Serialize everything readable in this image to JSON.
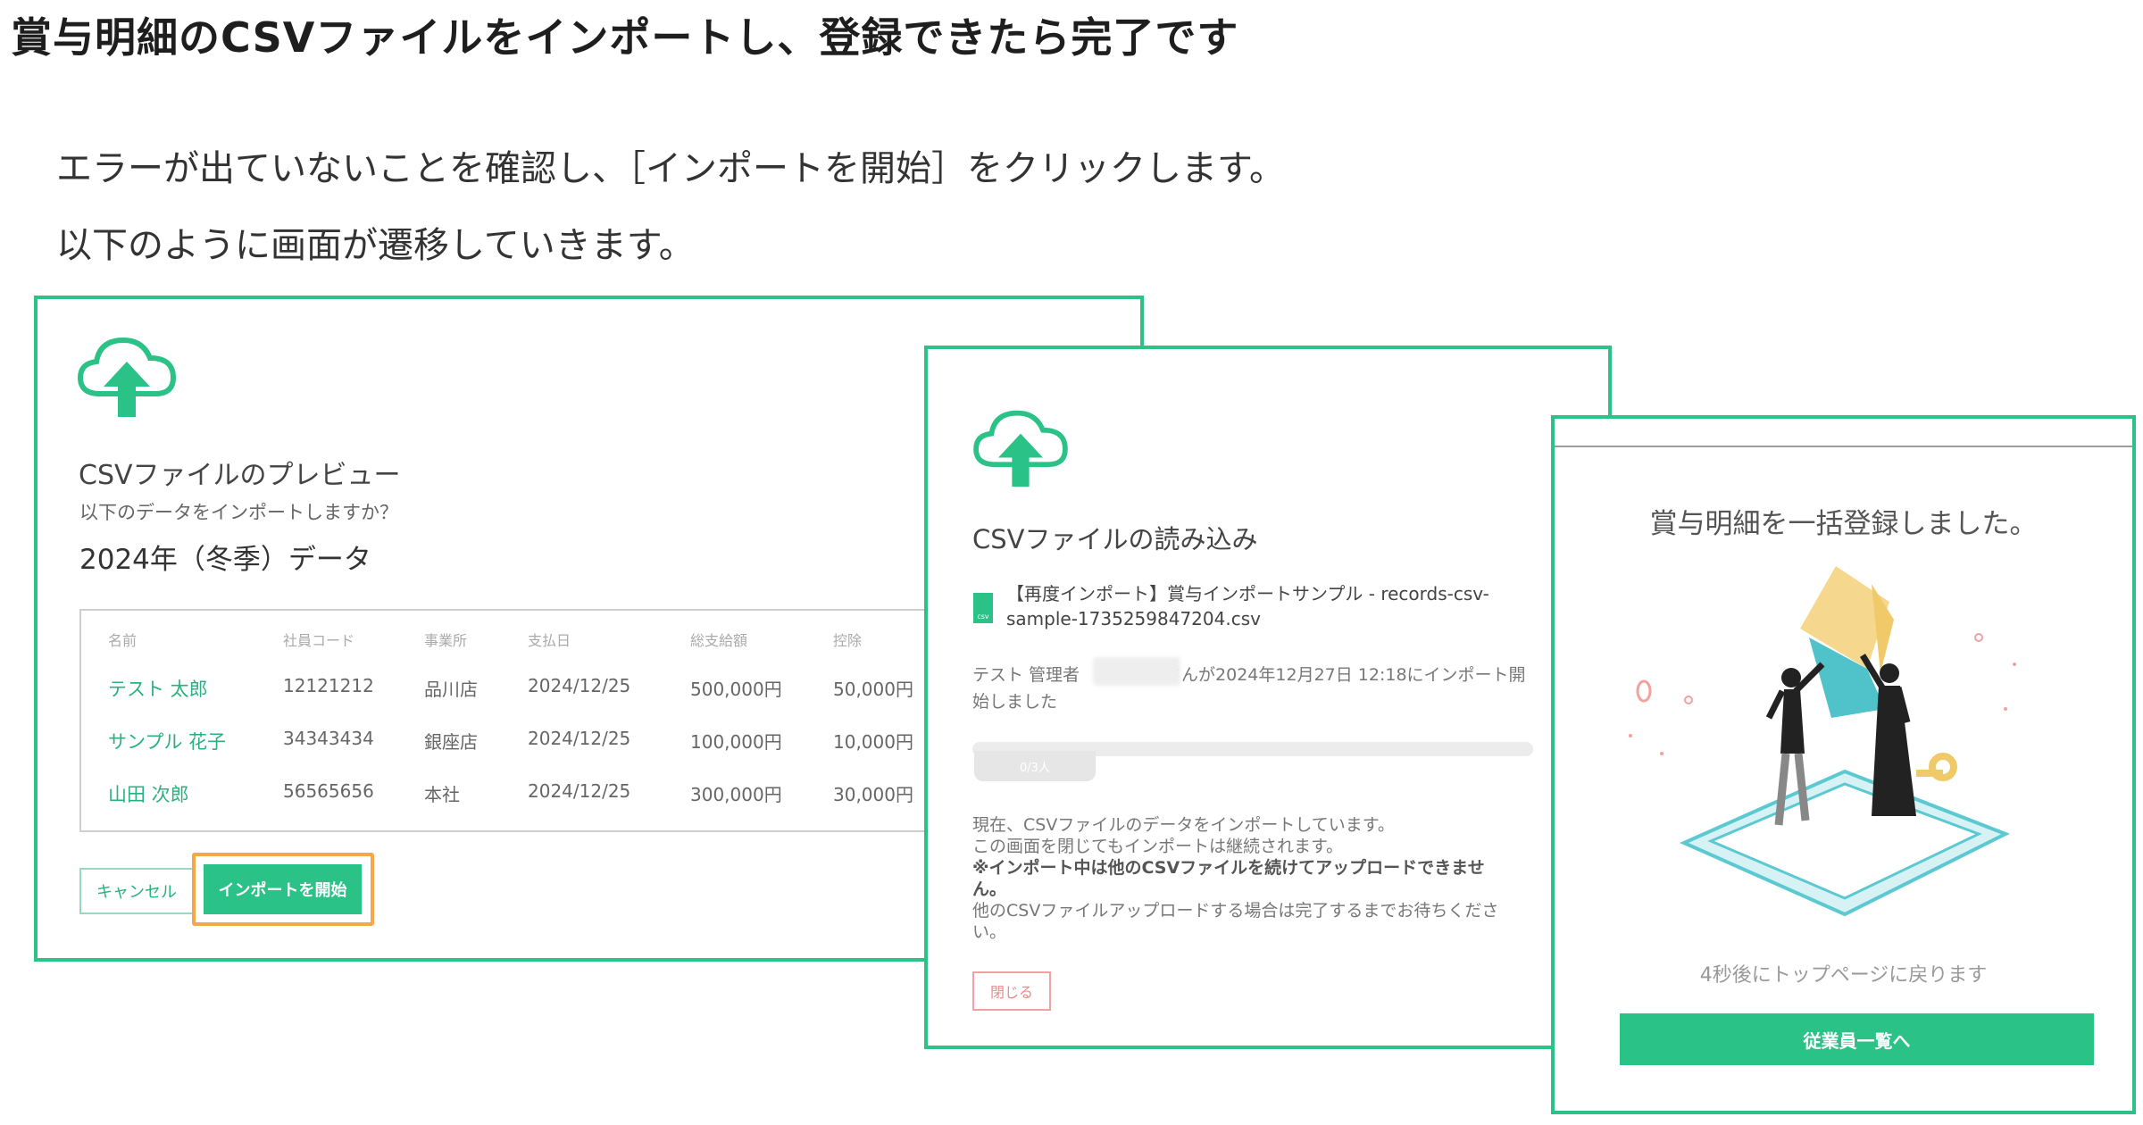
{
  "heading": "賞与明細のCSVファイルをインポートし、登録できたら完了です",
  "paragraphs": {
    "p1": "エラーが出ていないことを確認し、［インポートを開始］をクリックします。",
    "p2": "以下のように画面が遷移していきます。"
  },
  "colors": {
    "accent": "#2bc288",
    "highlight": "#f4a84a",
    "danger": "#e58a8a"
  },
  "preview": {
    "icon": "cloud-upload-icon",
    "title": "CSVファイルのプレビュー",
    "question": "以下のデータをインポートしますか？",
    "data_title": "2024年（冬季）データ",
    "table": {
      "headers": [
        "名前",
        "社員コード",
        "事業所",
        "支払日",
        "総支給額",
        "控除"
      ],
      "rows": [
        [
          "テスト 太郎",
          "12121212",
          "品川店",
          "2024/12/25",
          "500,000円",
          "50,000円"
        ],
        [
          "サンプル 花子",
          "34343434",
          "銀座店",
          "2024/12/25",
          "100,000円",
          "10,000円"
        ],
        [
          "山田 次郎",
          "56565656",
          "本社",
          "2024/12/25",
          "300,000円",
          "30,000円"
        ]
      ]
    },
    "cancel_label": "キャンセル",
    "import_label": "インポートを開始"
  },
  "loading": {
    "icon": "cloud-upload-icon",
    "title": "CSVファイルの読み込み",
    "file_line1": "【再度インポート】賞与インポートサンプル - records-csv-",
    "file_line2": "sample-1735259847204.csv",
    "start_line1": "テスト 管理者　　　　　さんが2024年12月27日 12:18にインポート開",
    "start_line2": "始しました",
    "progress": {
      "label": "0/3人",
      "done": 0,
      "total": 3
    },
    "messages": [
      {
        "text": "現在、CSVファイルのデータをインポートしています。",
        "bold": false
      },
      {
        "text": "この画面を閉じてもインポートは継続されます。",
        "bold": false
      },
      {
        "text": "※インポート中は他のCSVファイルを続けてアップロードできませ",
        "bold": true
      },
      {
        "text": "ん。",
        "bold": true
      },
      {
        "text": "他のCSVファイルアップロードする場合は完了するまでお待ちくださ",
        "bold": false
      },
      {
        "text": "い。",
        "bold": false
      }
    ],
    "close_label": "閉じる"
  },
  "complete": {
    "title": "賞与明細を一括登録しました。",
    "illustration": "celebration-illustration",
    "return_text": "4秒後にトップページに戻ります",
    "button_label": "従業員一覧へ"
  }
}
